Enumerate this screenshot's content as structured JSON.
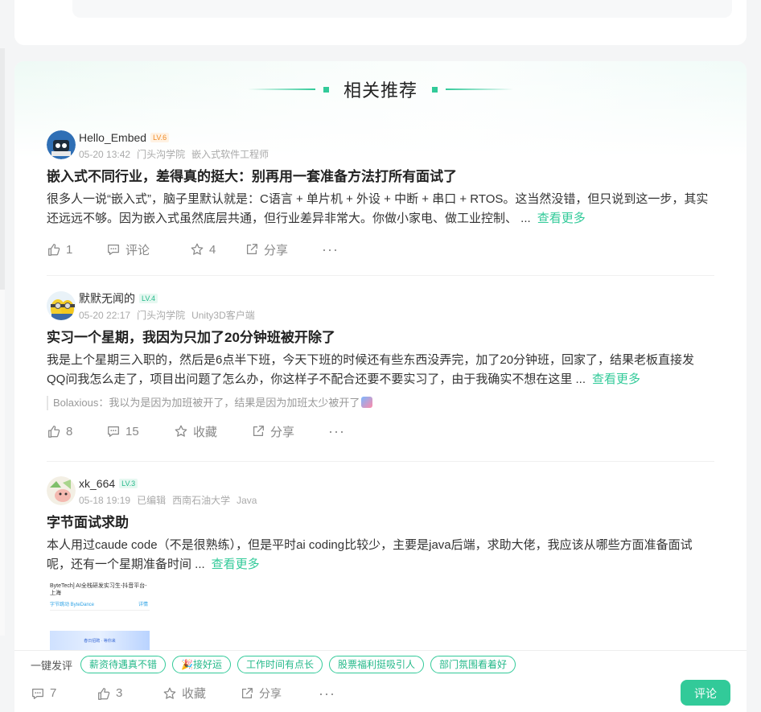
{
  "section": {
    "title": "相关推荐"
  },
  "posts": [
    {
      "user": "Hello_Embed",
      "level": "LV.6",
      "time": "05-20 13:42",
      "org": "门头沟学院",
      "role": "嵌入式软件工程师",
      "title": "嵌入式不同行业，差得真的挺大：别再用一套准备方法打所有面试了",
      "body": "很多人一说“嵌入式”，脑子里默认就是：C语言 + 单片机 + 外设 + 中断 + 串口 + RTOS。这当然没错，但只说到这一步，其实还远远不够。因为嵌入式虽然底层共通，但行业差异非常大。你做小家电、做工业控制、 ...",
      "more": "查看更多",
      "likes": "1",
      "comment_label": "评论",
      "stars": "4",
      "share_label": "分享"
    },
    {
      "user": "默默无闻的",
      "level": "LV.4",
      "time": "05-20 22:17",
      "org": "门头沟学院",
      "role": "Unity3D客户端",
      "title": "实习一个星期，我因为只加了20分钟班被开除了",
      "body": "我是上个星期三入职的，然后是6点半下班，今天下班的时候还有些东西没弄完，加了20分钟班，回家了，结果老板直接发QQ问我怎么走了，项目出问题了怎么办，你这样子不配合还要不要实习了，由于我确实不想在这里 ...",
      "more": "查看更多",
      "comment_preview": "Bolaxious：我以为是因为加班被开了，结果是因为加班太少被开了",
      "likes": "8",
      "comments": "15",
      "star_label": "收藏",
      "share_label": "分享"
    },
    {
      "user": "xk_664",
      "level": "LV.3",
      "time": "05-18 19:19",
      "edited": "已编辑",
      "org": "西南石油大学",
      "role": "Java",
      "title": "字节面试求助",
      "body": "本人用过caude code（不是很熟练），但是平时ai coding比较少，主要是java后端，求助大佬，我应该从哪些方面准备面试呢，还有一个星期准备时间 ...",
      "more": "查看更多",
      "thumb": {
        "line1": "ByteTech] AI全栈研发实习生-抖音平台-上海",
        "company": "字节跳动 ByteDance",
        "detail": "详情",
        "banner": "春日招聘 · 等你来"
      }
    }
  ],
  "bottom": {
    "quick_label": "一键发评",
    "chips": [
      "薪资待遇真不错",
      "🎉接好运",
      "工作时间有点长",
      "股票福利挺吸引人",
      "部门氛围看着好"
    ],
    "comments": "7",
    "likes": "3",
    "star_label": "收藏",
    "share_label": "分享",
    "submit_label": "评论"
  },
  "colors": {
    "accent": "#32ca99",
    "level_orange": "#f08a24"
  }
}
